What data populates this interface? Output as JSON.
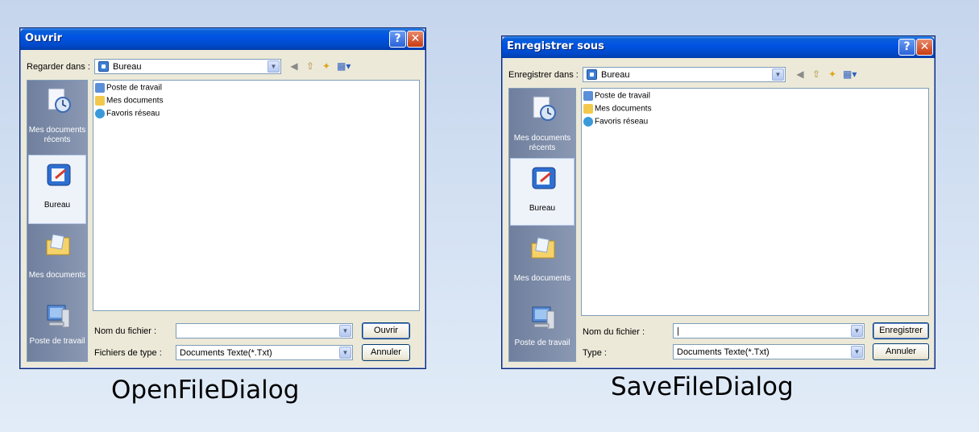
{
  "open_dialog": {
    "title": "Ouvrir",
    "help_glyph": "?",
    "close_glyph": "✕",
    "look_in_label": "Regarder dans :",
    "look_in_value": "Bureau",
    "places": [
      "Mes documents récents",
      "Bureau",
      "Mes documents",
      "Poste de travail"
    ],
    "files": [
      "Poste de travail",
      "Mes documents",
      "Favoris réseau"
    ],
    "filename_label": "Nom du fichier :",
    "filename_value": "",
    "filetype_label": "Fichiers de type :",
    "filetype_value": "Documents Texte(*.Txt)",
    "primary_button": "Ouvrir",
    "cancel_button": "Annuler",
    "caption": "OpenFileDialog"
  },
  "save_dialog": {
    "title": "Enregistrer sous",
    "help_glyph": "?",
    "close_glyph": "✕",
    "look_in_label": "Enregistrer dans :",
    "look_in_value": "Bureau",
    "places": [
      "Mes documents récents",
      "Bureau",
      "Mes documents",
      "Poste de travail"
    ],
    "files": [
      "Poste de travail",
      "Mes documents",
      "Favoris réseau"
    ],
    "filename_label": "Nom du fichier :",
    "filename_value": "|",
    "filetype_label": "Type :",
    "filetype_value": "Documents Texte(*.Txt)",
    "primary_button": "Enregistrer",
    "cancel_button": "Annuler",
    "caption": "SaveFileDialog"
  },
  "icons": {
    "back": "back-arrow-icon",
    "up": "up-folder-icon",
    "new_folder": "new-folder-icon",
    "views": "views-menu-icon"
  },
  "colors": {
    "titlebar": "#0054e3",
    "dialog_bg": "#ece9d8",
    "places_bar": "#7a89a6",
    "close_red": "#c83b12"
  }
}
